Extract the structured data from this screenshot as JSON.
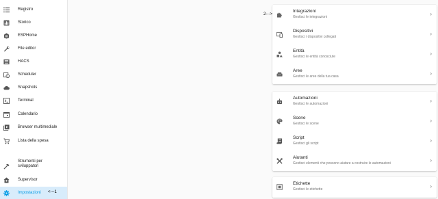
{
  "sidebar": {
    "items": [
      {
        "label": "Registro",
        "icon": "list-icon"
      },
      {
        "label": "Storico",
        "icon": "chart-box-icon"
      },
      {
        "label": "ESPHome",
        "icon": "esphome-icon"
      },
      {
        "label": "File editor",
        "icon": "wrench-icon"
      },
      {
        "label": "HACS",
        "icon": "hacs-icon"
      },
      {
        "label": "Scheduler",
        "icon": "calendar-clock-icon"
      },
      {
        "label": "Snapshots",
        "icon": "cloud-icon"
      },
      {
        "label": "Terminal",
        "icon": "console-icon"
      },
      {
        "label": "Calendario",
        "icon": "calendar-icon"
      },
      {
        "label": "Browser multimediale",
        "icon": "media-icon"
      },
      {
        "label": "Lista della spesa",
        "icon": "cart-icon"
      }
    ],
    "developer_tools_label": "Strumenti per sviluppatori",
    "supervisor_label": "Supervisor",
    "settings_label": "Impostazioni",
    "settings_annotation": "<---1"
  },
  "annotation_2": "2--->",
  "colors": {
    "accent": "#039be5",
    "active_bg": "#d8ecfb"
  },
  "groups": [
    {
      "rows": [
        {
          "title": "Integrazioni",
          "subtitle": "Gestisci le integrazioni",
          "icon": "puzzle-icon"
        },
        {
          "title": "Dispositivi",
          "subtitle": "Gestisci i dispositivi collegati",
          "icon": "devices-icon"
        },
        {
          "title": "Entità",
          "subtitle": "Gestisci le entità conosciute",
          "icon": "shapes-icon"
        },
        {
          "title": "Aree",
          "subtitle": "Gestisci le aree della tua casa",
          "icon": "sofa-icon"
        }
      ]
    },
    {
      "rows": [
        {
          "title": "Automazioni",
          "subtitle": "Gestisci le automazioni",
          "icon": "robot-icon"
        },
        {
          "title": "Scene",
          "subtitle": "Gestisci le scene",
          "icon": "palette-icon"
        },
        {
          "title": "Script",
          "subtitle": "Gestisci gli script",
          "icon": "script-icon"
        },
        {
          "title": "Aiutanti",
          "subtitle": "Gestisci elementi che possono aiutare a costruire le automazioni",
          "icon": "tools-icon"
        }
      ]
    },
    {
      "rows": [
        {
          "title": "Etichette",
          "subtitle": "Gestisci le etichette",
          "icon": "label-icon"
        }
      ]
    }
  ],
  "chevron": "›"
}
